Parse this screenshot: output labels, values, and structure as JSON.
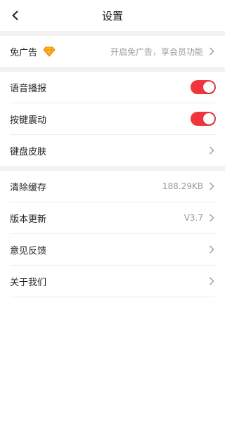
{
  "header": {
    "title": "设置"
  },
  "ad_row": {
    "label": "免广告",
    "value": "开启免广告，享会员功能"
  },
  "voice_row": {
    "label": "语音播报",
    "toggle_on": true
  },
  "vibrate_row": {
    "label": "按键震动",
    "toggle_on": true
  },
  "skin_row": {
    "label": "键盘皮肤"
  },
  "cache_row": {
    "label": "清除缓存",
    "value": "188.29KB"
  },
  "version_row": {
    "label": "版本更新",
    "value": "V3.7"
  },
  "feedback_row": {
    "label": "意见反馈"
  },
  "about_row": {
    "label": "关于我们"
  },
  "colors": {
    "accent": "#f2353b",
    "divider": "#f2f2f2",
    "secondary_text": "#9a9a9a"
  }
}
